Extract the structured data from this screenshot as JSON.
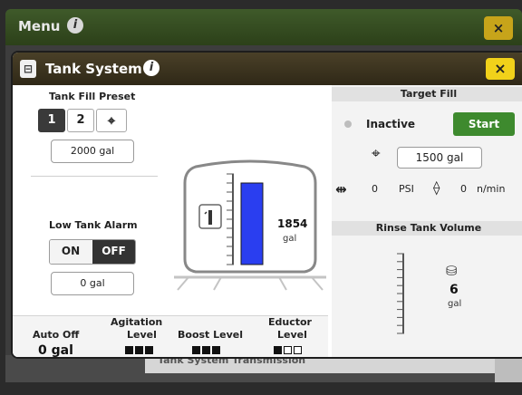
{
  "background": {
    "title": "Menu",
    "close_label": "×",
    "bottom_tabs": "Tank System   Transmission"
  },
  "dialog": {
    "title": "Tank System",
    "close_label": "×"
  },
  "tank_fill_preset": {
    "label": "Tank Fill Preset",
    "presets": [
      "1",
      "2"
    ],
    "selected": "1",
    "value": "2000 gal"
  },
  "low_tank_alarm": {
    "label": "Low Tank Alarm",
    "on_label": "ON",
    "off_label": "OFF",
    "state": "OFF",
    "value": "0 gal"
  },
  "tank_gauge": {
    "volume": "1854",
    "unit": "gal",
    "fill_fraction": 0.9
  },
  "bottom_row": {
    "agitation_label": "Agitation",
    "auto_off_label": "Auto Off",
    "auto_off_value": "0 gal",
    "level_label": "Level",
    "boost_level_label": "Boost Level",
    "eductor_label": "Eductor",
    "eductor_level_label": "Level",
    "agitation_level": 3,
    "boost_level": 3,
    "eductor_level": 1
  },
  "target_fill": {
    "header": "Target Fill",
    "status": "Inactive",
    "start_label": "Start",
    "value": "1500 gal",
    "pressure_value": "0",
    "pressure_unit": "PSI",
    "flow_value": "0",
    "flow_unit": "n/min"
  },
  "rinse_tank": {
    "header": "Rinse Tank Volume",
    "volume": "6",
    "unit": "gal",
    "fill_fraction": 0.0
  },
  "colors": {
    "accent_green": "#3e8a2e",
    "tank_fill": "#2a3ef0",
    "close_yellow": "#f1d11a"
  }
}
